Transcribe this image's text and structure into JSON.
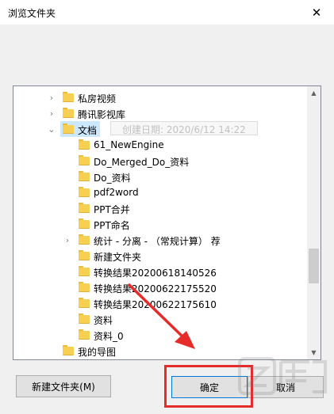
{
  "window": {
    "title": "浏览文件夹",
    "close_glyph": "✕"
  },
  "tooltip": "创建日期: 2020/6/12 14:22",
  "tree": {
    "items": [
      {
        "label": "私房视频",
        "expander": "›",
        "selected": false
      },
      {
        "label": "腾讯影视库",
        "expander": "›",
        "selected": false
      },
      {
        "label": "文档",
        "expander": "⌄",
        "selected": true
      },
      {
        "label": "61_NewEngine",
        "expander": "",
        "selected": false
      },
      {
        "label": "Do_Merged_Do_资料",
        "expander": "",
        "selected": false
      },
      {
        "label": "Do_资料",
        "expander": "",
        "selected": false
      },
      {
        "label": "pdf2word",
        "expander": "",
        "selected": false
      },
      {
        "label": "PPT合并",
        "expander": "",
        "selected": false
      },
      {
        "label": "PPT命名",
        "expander": "",
        "selected": false
      },
      {
        "label": "统计 - 分离 - （常规计算） 荐",
        "expander": "›",
        "selected": false
      },
      {
        "label": "新建文件夹",
        "expander": "",
        "selected": false
      },
      {
        "label": "转换结果20200618140526",
        "expander": "",
        "selected": false
      },
      {
        "label": "转换结果20200622175520",
        "expander": "",
        "selected": false
      },
      {
        "label": "转换结果20200622175610",
        "expander": "",
        "selected": false
      },
      {
        "label": "资料",
        "expander": "",
        "selected": false
      },
      {
        "label": "资料_0",
        "expander": "",
        "selected": false
      },
      {
        "label": "我的导图",
        "expander": "",
        "selected": false
      }
    ]
  },
  "buttons": {
    "new_folder": "新建文件夹(M)",
    "ok": "确定",
    "cancel": "取消"
  },
  "colors": {
    "highlight": "#e62b2b",
    "selection": "#cce8ff",
    "folder": "#f7cf52"
  }
}
